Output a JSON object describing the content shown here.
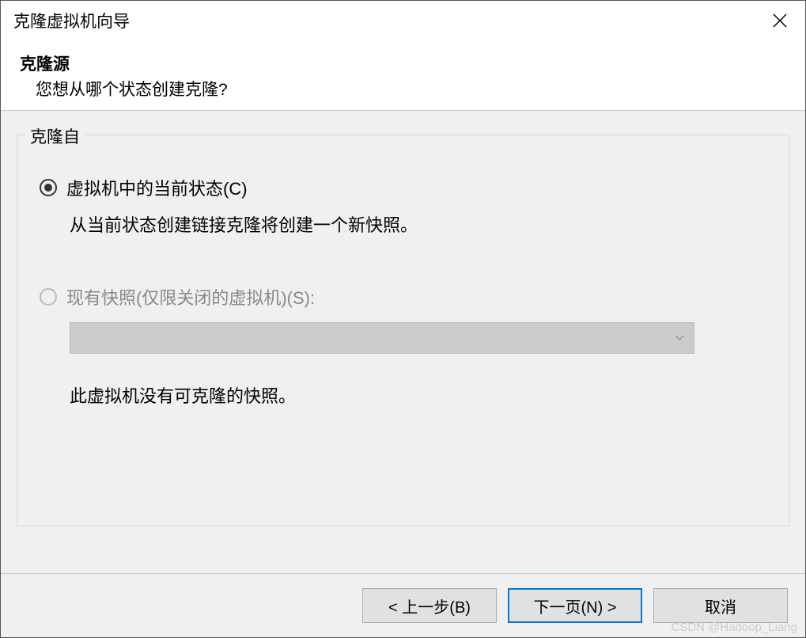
{
  "titlebar": {
    "title": "克隆虚拟机向导"
  },
  "header": {
    "title": "克隆源",
    "subtitle": "您想从哪个状态创建克隆?"
  },
  "fieldset": {
    "legend": "克隆自",
    "option_current": {
      "label": "虚拟机中的当前状态(C)",
      "desc": "从当前状态创建链接克隆将创建一个新快照。",
      "selected": true
    },
    "option_snapshot": {
      "label": "现有快照(仅限关闭的虚拟机)(S):",
      "enabled": false,
      "empty_msg": "此虚拟机没有可克隆的快照。"
    }
  },
  "footer": {
    "back": "< 上一步(B)",
    "next": "下一页(N) >",
    "cancel": "取消"
  },
  "watermark": "CSDN @Hadoop_Liang"
}
